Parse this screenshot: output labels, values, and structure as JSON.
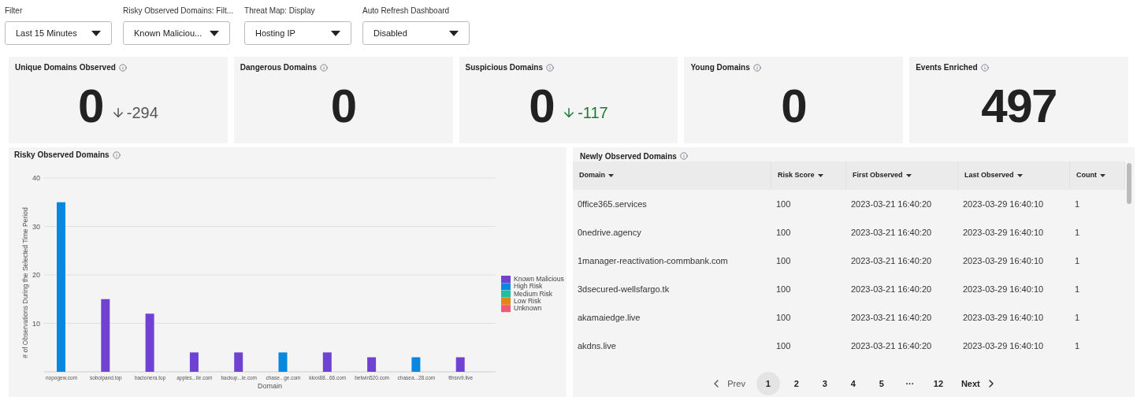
{
  "filters": [
    {
      "label": "Filter",
      "value": "Last 15 Minutes"
    },
    {
      "label": "Risky Observed Domains: Filt...",
      "value": "Known Maliciou..."
    },
    {
      "label": "Threat Map: Display",
      "value": "Hosting IP"
    },
    {
      "label": "Auto Refresh Dashboard",
      "value": "Disabled"
    }
  ],
  "stats": [
    {
      "title": "Unique Domains Observed",
      "value": "0",
      "change": "-294",
      "color": "#555555"
    },
    {
      "title": "Dangerous Domains",
      "value": "0"
    },
    {
      "title": "Suspicious Domains",
      "value": "0",
      "change": "-117",
      "color": "#1b7a3a"
    },
    {
      "title": "Young Domains",
      "value": "0"
    },
    {
      "title": "Events Enriched",
      "value": "497"
    }
  ],
  "risky_chart": {
    "title": "Risky Observed Domains",
    "chart_data": {
      "type": "bar",
      "grid": true,
      "legend": true,
      "xlabel": "Domain",
      "ylabel": "# of Observations During the Selected Time Period",
      "categories": [
        "nopogew.com",
        "sobolpand.top",
        "bacionera.top",
        "apples...ile.com",
        "backup...ie.com",
        "chase...ge.com",
        "kkxx88...66.com",
        "betwin520.com",
        "chasea...28.com",
        "tthsrv9.live"
      ],
      "ylim": [
        0,
        40
      ],
      "yticks": [
        10,
        20,
        30,
        40
      ],
      "series": [
        {
          "name": "Known Malicious",
          "color": "#6f42d2",
          "values": [
            null,
            15,
            12,
            4,
            4,
            null,
            4,
            3,
            null,
            3
          ]
        },
        {
          "name": "High Risk",
          "color": "#0a88e0",
          "values": [
            35,
            null,
            null,
            null,
            null,
            4,
            null,
            null,
            3,
            null
          ]
        },
        {
          "name": "Medium Risk",
          "color": "#1fbfa0",
          "values": [
            null,
            null,
            null,
            null,
            null,
            null,
            null,
            null,
            null,
            null
          ]
        },
        {
          "name": "Low Risk",
          "color": "#e0861c",
          "values": [
            null,
            null,
            null,
            null,
            null,
            null,
            null,
            null,
            null,
            null
          ]
        },
        {
          "name": "Unknown",
          "color": "#f0587a",
          "values": [
            null,
            null,
            null,
            null,
            null,
            null,
            null,
            null,
            null,
            null
          ]
        }
      ]
    }
  },
  "new_domains": {
    "title": "Newly Observed Domains",
    "columns": [
      "Domain",
      "Risk Score",
      "First Observed",
      "Last Observed",
      "Count"
    ],
    "rows": [
      [
        "0ffice365.services",
        "100",
        "2023-03-21 16:40:20",
        "2023-03-29 16:40:10",
        "1"
      ],
      [
        "0nedrive.agency",
        "100",
        "2023-03-21 16:40:20",
        "2023-03-29 16:40:10",
        "1"
      ],
      [
        "1manager-reactivation-commbank.com",
        "100",
        "2023-03-21 16:40:20",
        "2023-03-29 16:40:10",
        "1"
      ],
      [
        "3dsecured-wellsfargo.tk",
        "100",
        "2023-03-21 16:40:20",
        "2023-03-29 16:40:10",
        "1"
      ],
      [
        "akamaiedge.live",
        "100",
        "2023-03-21 16:40:20",
        "2023-03-29 16:40:10",
        "1"
      ],
      [
        "akdns.live",
        "100",
        "2023-03-21 16:40:20",
        "2023-03-29 16:40:10",
        "1"
      ]
    ],
    "pagination": {
      "prev": "Prev",
      "next": "Next",
      "pages": [
        {
          "label": "1",
          "selected": true
        },
        {
          "label": "2",
          "selected": false
        },
        {
          "label": "3",
          "selected": false
        },
        {
          "label": "4",
          "selected": false
        },
        {
          "label": "5",
          "selected": false
        },
        {
          "label": "···",
          "selected": false
        },
        {
          "label": "12",
          "selected": false
        }
      ]
    }
  }
}
